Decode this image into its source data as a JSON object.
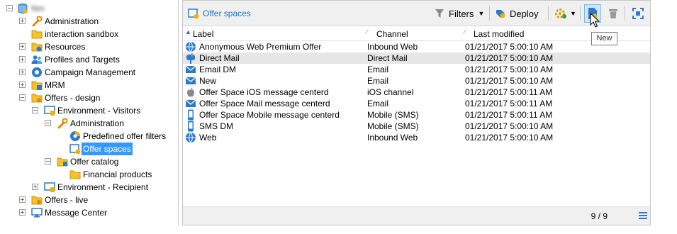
{
  "tree": {
    "root_label": "Nm",
    "items": [
      {
        "label": "Administration",
        "icon": "wrench-icon"
      },
      {
        "label": "interaction sandbox",
        "icon": "folder-icon"
      },
      {
        "label": "Resources",
        "icon": "resources-icon"
      },
      {
        "label": "Profiles and Targets",
        "icon": "profiles-icon"
      },
      {
        "label": "Campaign Management",
        "icon": "campaign-icon"
      },
      {
        "label": "MRM",
        "icon": "mrm-icon"
      },
      {
        "label": "Offers - design",
        "icon": "offers-folder-icon"
      },
      {
        "label": "Environment - Visitors",
        "icon": "environment-icon"
      },
      {
        "label": "Administration",
        "icon": "wrench-icon"
      },
      {
        "label": "Predefined offer filters",
        "icon": "filter-pie-icon"
      },
      {
        "label": "Offer spaces",
        "icon": "offer-space-icon"
      },
      {
        "label": "Offer catalog",
        "icon": "offer-catalog-icon"
      },
      {
        "label": "Financial products",
        "icon": "folder-icon"
      },
      {
        "label": "Environment - Recipient",
        "icon": "environment-icon"
      },
      {
        "label": "Offers - live",
        "icon": "offers-folder-icon"
      },
      {
        "label": "Message Center",
        "icon": "message-center-icon"
      }
    ]
  },
  "toolbar": {
    "title": "Offer spaces",
    "filters_label": "Filters",
    "deploy_label": "Deploy"
  },
  "tooltip": "New",
  "columns": {
    "label": "Label",
    "channel": "Channel",
    "modified": "Last modified"
  },
  "rows": [
    {
      "label": "Anonymous Web Premium Offer",
      "channel": "Inbound Web",
      "modified": "01/21/2017 5:00:10 AM",
      "icon": "globe-icon"
    },
    {
      "label": "Direct Mail",
      "channel": "Direct Mail",
      "modified": "01/21/2017 5:00:10 AM",
      "icon": "mailbox-icon"
    },
    {
      "label": "Email DM",
      "channel": "Email",
      "modified": "01/21/2017 5:00:10 AM",
      "icon": "envelope-icon"
    },
    {
      "label": "New",
      "channel": "Email",
      "modified": "01/21/2017 5:00:10 AM",
      "icon": "envelope-icon"
    },
    {
      "label": "Offer Space iOS message centerd",
      "channel": "iOS channel",
      "modified": "01/21/2017 5:00:11 AM",
      "icon": "apple-icon"
    },
    {
      "label": "Offer Space Mail message centerd",
      "channel": "Email",
      "modified": "01/21/2017 5:00:11 AM",
      "icon": "envelope-icon"
    },
    {
      "label": "Offer Space Mobile message centerd",
      "channel": "Mobile (SMS)",
      "modified": "01/21/2017 5:00:11 AM",
      "icon": "mobile-icon"
    },
    {
      "label": "SMS DM",
      "channel": "Mobile (SMS)",
      "modified": "01/21/2017 5:00:10 AM",
      "icon": "mobile-icon"
    },
    {
      "label": "Web",
      "channel": "Inbound Web",
      "modified": "01/21/2017 5:00:10 AM",
      "icon": "globe-icon"
    }
  ],
  "status": {
    "count": "9 / 9"
  },
  "colors": {
    "selection": "#3399ff",
    "accent_blue": "#1f6fc9",
    "highlight_row": "#e6e6e6"
  }
}
